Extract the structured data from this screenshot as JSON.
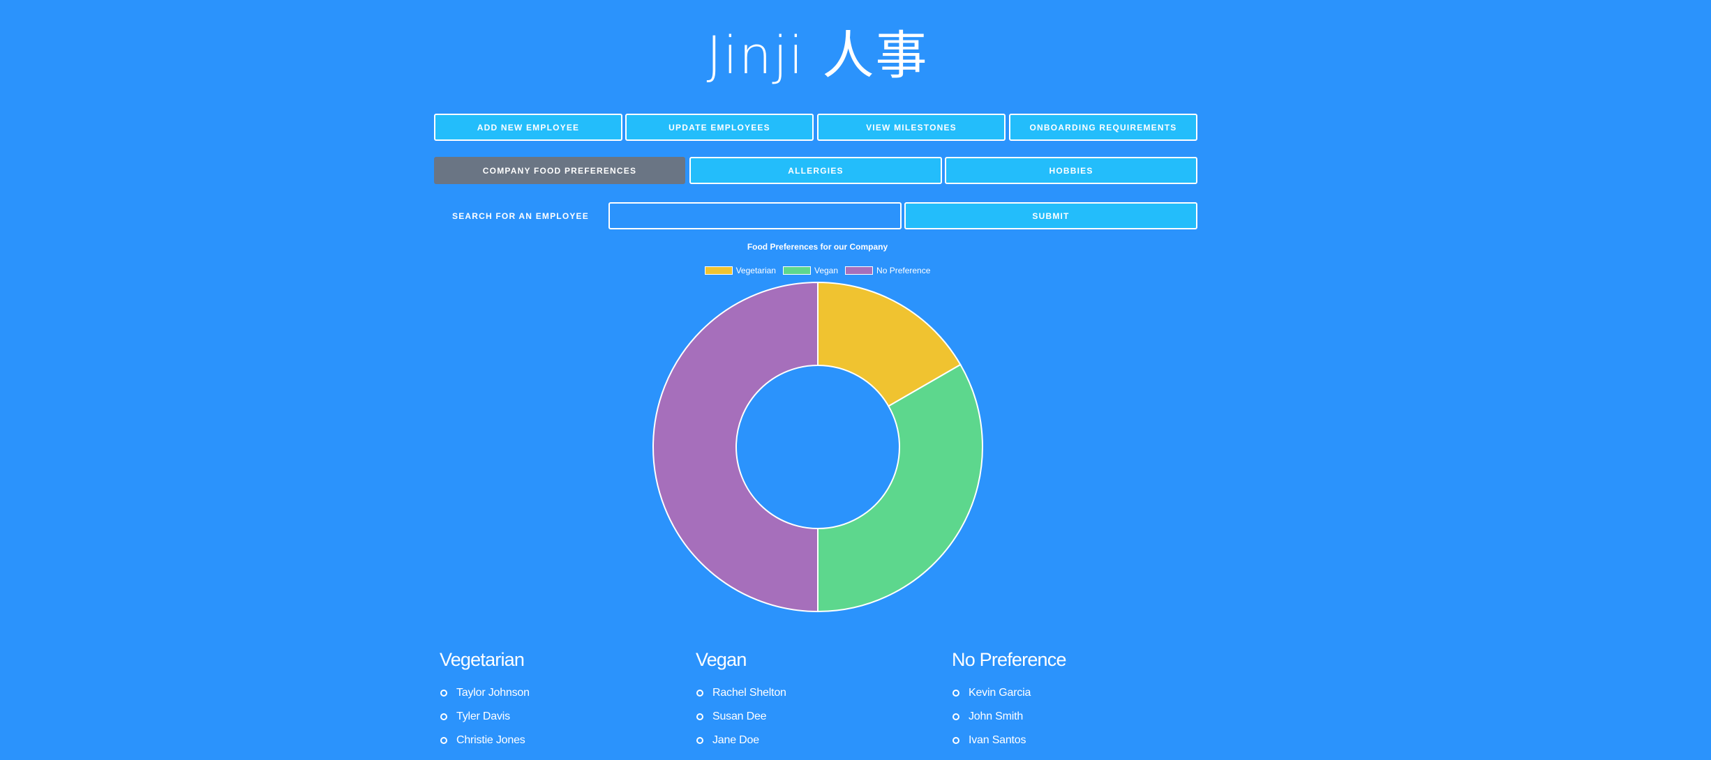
{
  "app": {
    "title": "Jinji 人事"
  },
  "nav": {
    "row1": [
      "ADD NEW EMPLOYEE",
      "UPDATE EMPLOYEES",
      "VIEW MILESTONES",
      "ONBOARDING REQUIREMENTS"
    ],
    "row2": [
      "COMPANY FOOD PREFERENCES",
      "ALLERGIES",
      "HOBBIES"
    ],
    "active": "COMPANY FOOD PREFERENCES"
  },
  "search": {
    "label": "SEARCH FOR AN EMPLOYEE",
    "value": "",
    "submit_label": "SUBMIT"
  },
  "colors": {
    "background": "#2b93fc",
    "button": "#23bdfb",
    "active_button": "#6a7584"
  },
  "chart_data": {
    "type": "pie",
    "title": "Food Preferences for our Company",
    "categories": [
      "Vegetarian",
      "Vegan",
      "No Preference"
    ],
    "values": [
      1,
      2,
      3
    ],
    "colors": [
      "#f0c330",
      "#5dd78d",
      "#a66fbb"
    ],
    "legend_position": "top"
  },
  "lists": [
    {
      "heading": "Vegetarian",
      "items": [
        "Taylor Johnson",
        "Tyler Davis",
        "Christie Jones"
      ]
    },
    {
      "heading": "Vegan",
      "items": [
        "Rachel Shelton",
        "Susan Dee",
        "Jane Doe"
      ]
    },
    {
      "heading": "No Preference",
      "items": [
        "Kevin Garcia",
        "John Smith",
        "Ivan Santos"
      ]
    }
  ]
}
